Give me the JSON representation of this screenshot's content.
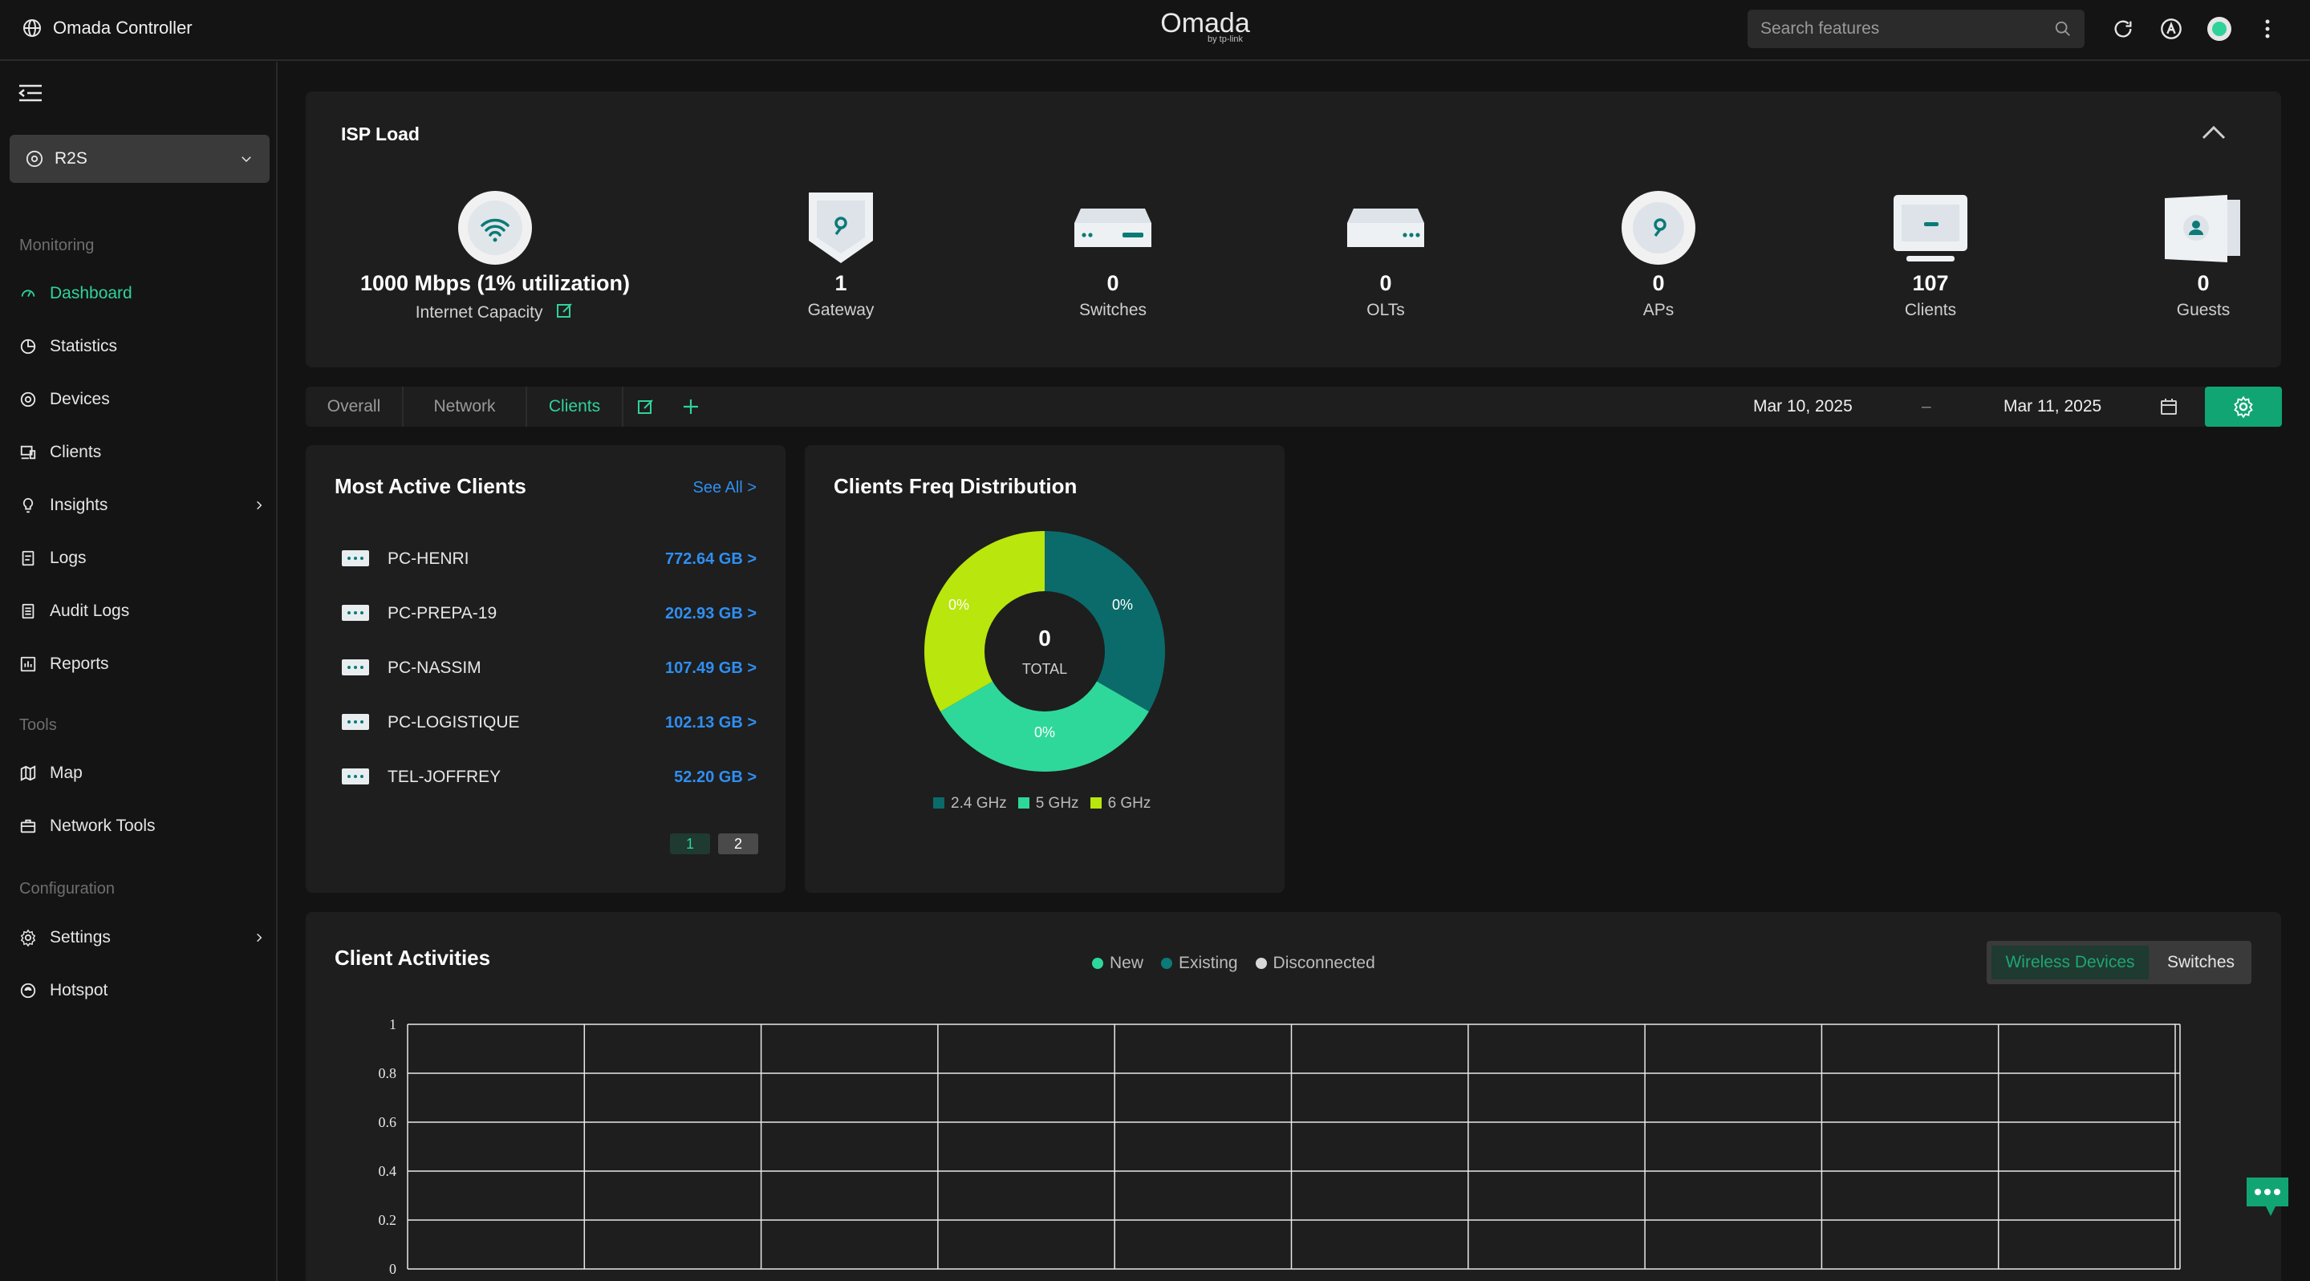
{
  "topbar": {
    "app_title": "Omada Controller",
    "brand": "Omada",
    "brand_sub": "by tp-link",
    "search_placeholder": "Search features"
  },
  "sidebar": {
    "site": "R2S",
    "sections": {
      "monitoring": "Monitoring",
      "tools": "Tools",
      "configuration": "Configuration"
    },
    "items": [
      {
        "label": "Dashboard",
        "icon": "dashboard-icon"
      },
      {
        "label": "Statistics",
        "icon": "statistics-icon"
      },
      {
        "label": "Devices",
        "icon": "devices-icon"
      },
      {
        "label": "Clients",
        "icon": "clients-icon"
      },
      {
        "label": "Insights",
        "icon": "insights-icon"
      },
      {
        "label": "Logs",
        "icon": "logs-icon"
      },
      {
        "label": "Audit Logs",
        "icon": "audit-logs-icon"
      },
      {
        "label": "Reports",
        "icon": "reports-icon"
      },
      {
        "label": "Map",
        "icon": "map-icon"
      },
      {
        "label": "Network Tools",
        "icon": "network-tools-icon"
      },
      {
        "label": "Settings",
        "icon": "settings-icon"
      },
      {
        "label": "Hotspot",
        "icon": "hotspot-icon"
      }
    ]
  },
  "isp": {
    "title": "ISP Load",
    "capacity_value": "1000 Mbps (1% utilization)",
    "capacity_label": "Internet Capacity",
    "metrics": [
      {
        "value": "1",
        "label": "Gateway"
      },
      {
        "value": "0",
        "label": "Switches"
      },
      {
        "value": "0",
        "label": "OLTs"
      },
      {
        "value": "0",
        "label": "APs"
      },
      {
        "value": "107",
        "label": "Clients"
      },
      {
        "value": "0",
        "label": "Guests"
      }
    ]
  },
  "tabs": {
    "overall": "Overall",
    "network": "Network",
    "clients": "Clients"
  },
  "date_range": {
    "start": "Mar 10, 2025",
    "sep": "–",
    "end": "Mar 11, 2025"
  },
  "most_active": {
    "title": "Most Active Clients",
    "see_all": "See All >",
    "clients": [
      {
        "name": "PC-HENRI",
        "usage": "772.64 GB >"
      },
      {
        "name": "PC-PREPA-19",
        "usage": "202.93 GB >"
      },
      {
        "name": "PC-NASSIM",
        "usage": "107.49 GB >"
      },
      {
        "name": "PC-LOGISTIQUE",
        "usage": "102.13 GB >"
      },
      {
        "name": "TEL-JOFFREY",
        "usage": "52.20 GB >"
      }
    ],
    "pages": [
      "1",
      "2"
    ]
  },
  "freq": {
    "title": "Clients Freq Distribution",
    "total_value": "0",
    "total_label": "TOTAL",
    "slices": [
      {
        "label": "2.4 GHz",
        "pct": "0%",
        "color": "#0b6b6b"
      },
      {
        "label": "5 GHz",
        "pct": "0%",
        "color": "#2ed89a"
      },
      {
        "label": "6 GHz",
        "pct": "0%",
        "color": "#b9e60c"
      }
    ]
  },
  "activities": {
    "title": "Client Activities",
    "legend": [
      {
        "label": "New",
        "color": "#2ed89a"
      },
      {
        "label": "Existing",
        "color": "#0b7a78"
      },
      {
        "label": "Disconnected",
        "color": "#d8d8d8"
      }
    ],
    "seg": {
      "wireless": "Wireless Devices",
      "switches": "Switches"
    }
  },
  "chart_data": {
    "type": "line",
    "title": "Client Activities",
    "series": [
      {
        "name": "New",
        "values": []
      },
      {
        "name": "Existing",
        "values": []
      },
      {
        "name": "Disconnected",
        "values": []
      }
    ],
    "ylim": [
      0,
      1
    ],
    "yticks": [
      "1",
      "0.8",
      "0.6",
      "0.4",
      "0.2",
      "0"
    ],
    "grid": true,
    "legend": "top"
  },
  "colors": {
    "accent": "#2fd39a",
    "link": "#2f8ff2",
    "button": "#11a574"
  }
}
